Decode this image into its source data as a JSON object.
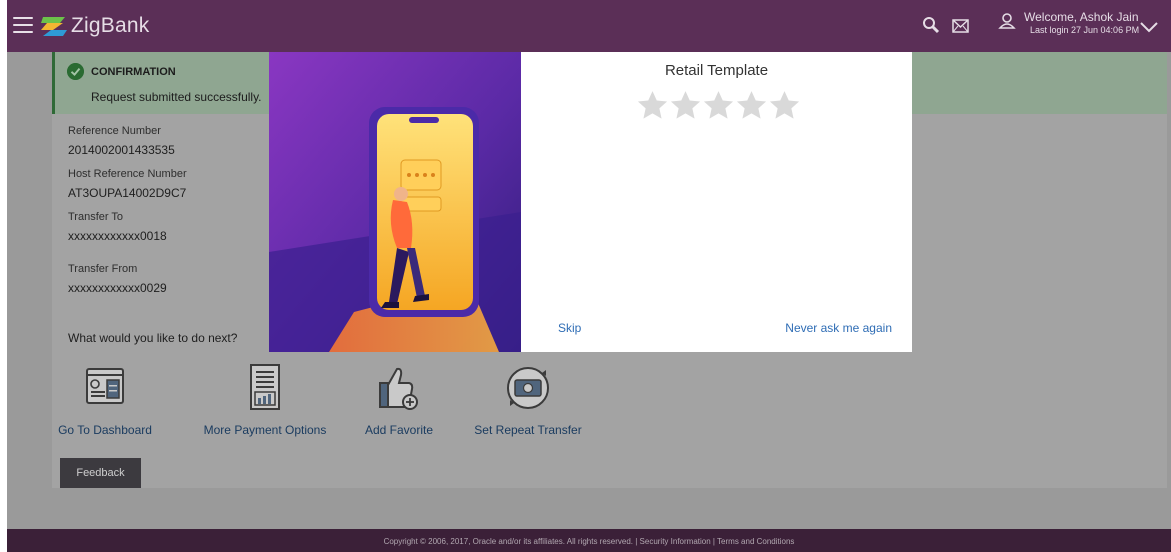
{
  "header": {
    "app_name": "ZigBank",
    "welcome": "Welcome, Ashok Jain",
    "last_login": "Last login 27 Jun 04:06 PM"
  },
  "confirmation": {
    "title": "CONFIRMATION",
    "message": "Request submitted successfully."
  },
  "details": [
    {
      "label": "Reference Number",
      "value": "2014002001433535"
    },
    {
      "label": "Host Reference Number",
      "value": "AT3OUPA14002D9C7"
    },
    {
      "label": "Transfer To",
      "value": "xxxxxxxxxxxx0018"
    },
    {
      "label": "Transfer From",
      "value": "xxxxxxxxxxxx0029"
    }
  ],
  "next_prompt": "What would you like to do next?",
  "actions": [
    {
      "label": "Go To Dashboard",
      "icon": "dashboard-icon"
    },
    {
      "label": "More Payment Options",
      "icon": "document-chart-icon"
    },
    {
      "label": "Add Favorite",
      "icon": "thumbs-up-icon"
    },
    {
      "label": "Set Repeat Transfer",
      "icon": "repeat-transfer-icon"
    }
  ],
  "feedback_label": "Feedback",
  "footer": "Copyright © 2006, 2017, Oracle and/or its affiliates. All rights reserved. | Security Information | Terms and Conditions",
  "modal": {
    "title": "Retail Template",
    "rating": {
      "value": 0,
      "max": 5
    },
    "skip_label": "Skip",
    "never_label": "Never ask me again"
  },
  "colors": {
    "header": "#5b2f57",
    "footer": "#3b2038",
    "link": "#2f6db5",
    "success": "#2a6b32"
  }
}
